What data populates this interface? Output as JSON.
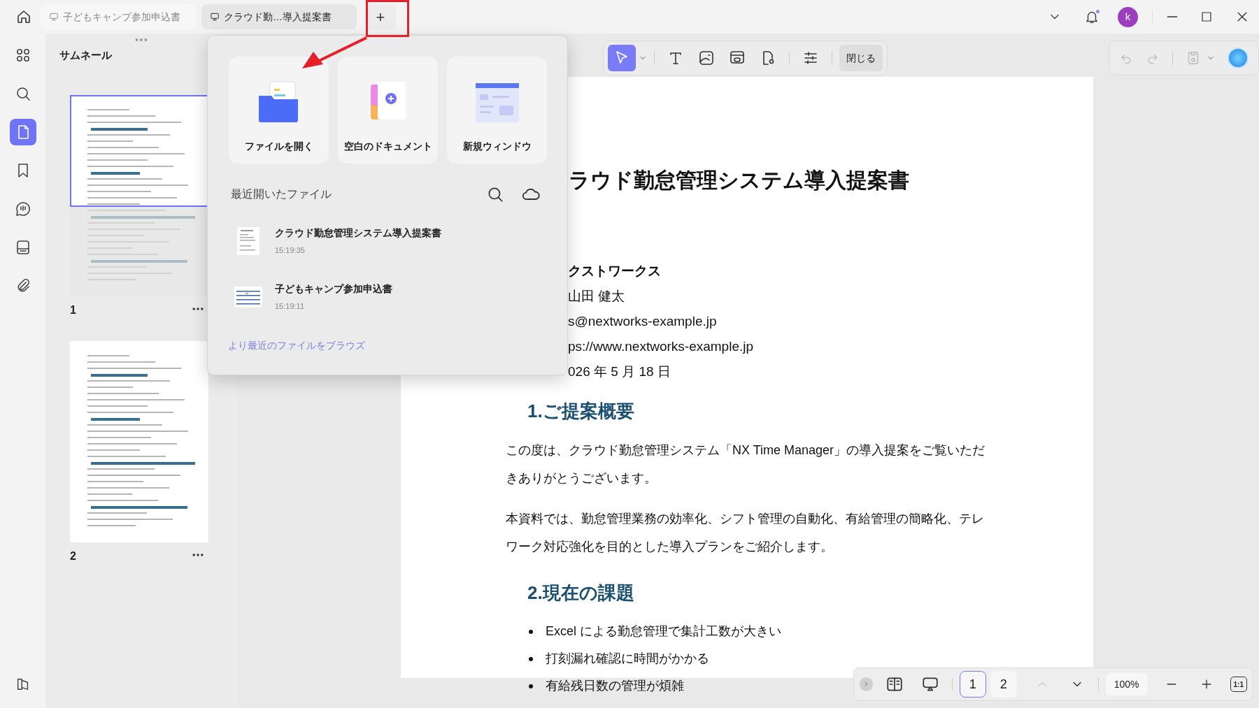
{
  "tabs": [
    {
      "label": "子どもキャンプ参加申込書",
      "selected": false
    },
    {
      "label": "クラウド勤…導入提案書",
      "selected": true
    }
  ],
  "new_tab_button": "+",
  "avatar": "k",
  "rail": [
    {
      "kind": "grid",
      "selected": false
    },
    {
      "kind": "search",
      "selected": false
    },
    {
      "kind": "pages",
      "selected": true
    },
    {
      "kind": "bookmark",
      "selected": false
    },
    {
      "kind": "comment",
      "selected": false
    },
    {
      "kind": "stamp",
      "selected": false
    },
    {
      "kind": "attachment",
      "selected": false
    }
  ],
  "thumbnails": {
    "title": "サムネール",
    "pages": [
      {
        "label": "1",
        "selected": true
      },
      {
        "label": "2",
        "selected": false
      }
    ]
  },
  "toolbar": {
    "tools": [
      {
        "kind": "select",
        "selected": true
      },
      {
        "kind": "text",
        "selected": false
      },
      {
        "kind": "image",
        "selected": false
      },
      {
        "kind": "link",
        "selected": false
      },
      {
        "kind": "location",
        "selected": false
      },
      {
        "kind": "settings",
        "selected": false
      }
    ],
    "close_button": "閉じる"
  },
  "new_menu": {
    "actions": [
      {
        "kind": "open",
        "label": "ファイルを開く"
      },
      {
        "kind": "blank",
        "label": "空白のドキュメント"
      },
      {
        "kind": "window",
        "label": "新規ウィンドウ"
      }
    ],
    "recent_title": "最近開いたファイル",
    "recent_files": [
      {
        "kind": "text",
        "name": "クラウド勤怠管理システム導入提案書",
        "time": "15:19:35"
      },
      {
        "kind": "form",
        "name": "子どもキャンプ参加申込書",
        "time": "15:19:11"
      }
    ],
    "browse_link": "より最近のファイルをブラウズ"
  },
  "document": {
    "blocks": [
      {
        "kind": "title",
        "text": "ラウド勤怠管理システム導入提案書"
      },
      {
        "kind": "info",
        "text": "クストワークス",
        "bold": true
      },
      {
        "kind": "info",
        "text": "山田 健太",
        "bold": false
      },
      {
        "kind": "info",
        "text": "s@nextworks-example.jp",
        "bold": false
      },
      {
        "kind": "info",
        "text": "ps://www.nextworks-example.jp",
        "bold": false
      },
      {
        "kind": "info",
        "text": "026 年 5 月 18 日",
        "bold": false
      },
      {
        "kind": "heading",
        "text": "1.ご提案概要"
      },
      {
        "kind": "paragraph",
        "text": "この度は、クラウド勤怠管理システム「NX Time Manager」の導入提案をご覧いただきありがとうございます。"
      },
      {
        "kind": "paragraph",
        "text": "本資料では、勤怠管理業務の効率化、シフト管理の自動化、有給管理の簡略化、テレワーク対応強化を目的とした導入プランをご紹介します。"
      },
      {
        "kind": "heading",
        "text": "2.現在の課題"
      },
      {
        "kind": "bullet",
        "text": "Excel による勤怠管理で集計工数が大きい"
      },
      {
        "kind": "bullet",
        "text": "打刻漏れ確認に時間がかかる"
      },
      {
        "kind": "bullet",
        "text": "有給残日数の管理が煩雑"
      }
    ]
  },
  "page_nav": {
    "pages": [
      {
        "label": "1",
        "selected": true
      },
      {
        "label": "2",
        "selected": false
      }
    ],
    "zoom": "100%",
    "actual_size": "1:1"
  }
}
